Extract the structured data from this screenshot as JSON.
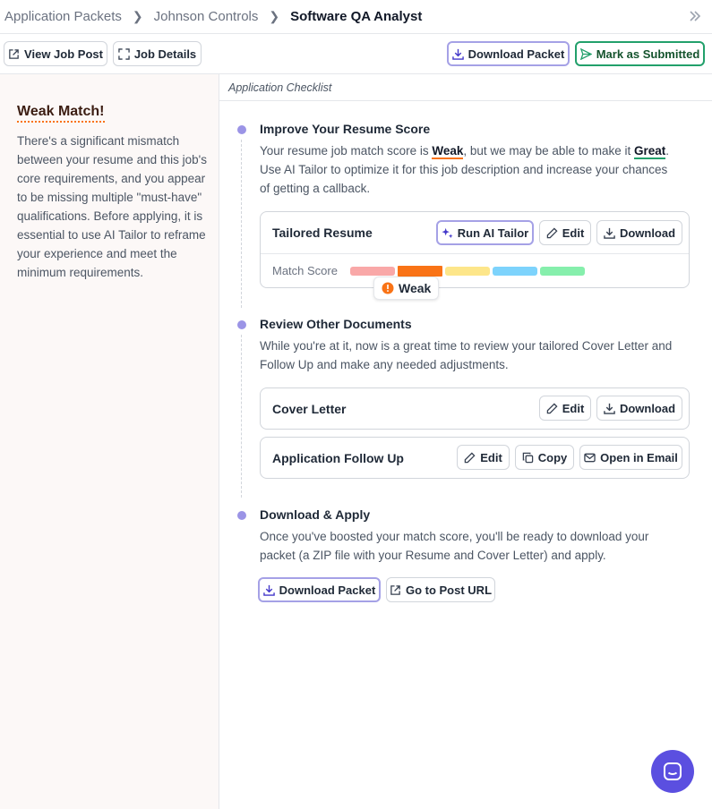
{
  "breadcrumb": {
    "items": [
      "Application Packets",
      "Johnson Controls",
      "Software QA Analyst"
    ]
  },
  "toolbar": {
    "view_job_post": "View Job Post",
    "job_details": "Job Details",
    "download_packet": "Download Packet",
    "mark_submitted": "Mark as Submitted"
  },
  "left_panel": {
    "title": "Weak Match!",
    "text": "There's a significant mismatch between your resume and this job's core requirements, and you appear to be missing multiple \"must-have\" qualifications. Before applying, it is essential to use AI Tailor to reframe your experience and meet the minimum requirements."
  },
  "checklist": {
    "header": "Application Checklist",
    "step1": {
      "title": "Improve Your Resume Score",
      "desc_a": "Your resume job match score is ",
      "desc_weak": "Weak",
      "desc_b": ", but we may be able to make it ",
      "desc_great": "Great",
      "desc_c": ". Use AI Tailor to optimize it for this job description and increase your chances of getting a callback.",
      "card_title": "Tailored Resume",
      "run_ai": "Run AI Tailor",
      "edit": "Edit",
      "download": "Download",
      "match_label": "Match Score",
      "score": "Weak",
      "score_level": 2,
      "score_levels": 5,
      "scale_colors": [
        "#f9a8a8",
        "#f97316",
        "#fde68a",
        "#7dd3fc",
        "#86efac"
      ]
    },
    "step2": {
      "title": "Review Other Documents",
      "desc": "While you're at it, now is a great time to review your tailored Cover Letter and Follow Up and make any needed adjustments.",
      "cover_title": "Cover Letter",
      "cover_edit": "Edit",
      "cover_download": "Download",
      "followup_title": "Application Follow Up",
      "followup_edit": "Edit",
      "followup_copy": "Copy",
      "followup_email": "Open in Email"
    },
    "step3": {
      "title": "Download & Apply",
      "desc": "Once you've boosted your match score, you'll be ready to download your packet (a ZIP file with your Resume and Cover Letter) and apply.",
      "download_packet": "Download Packet",
      "go_to_post": "Go to Post URL"
    }
  },
  "colors": {
    "accent": "#a5a1e6",
    "submit_green": "#22a06b",
    "weak_orange": "#f97316",
    "chat_bg": "#5b4fe0"
  },
  "icons": [
    "external-link-icon",
    "expand-icon",
    "download-icon",
    "send-icon",
    "sparkle-icon",
    "pencil-icon",
    "copy-icon",
    "mail-icon",
    "alert-icon",
    "chat-icon",
    "double-chevron-icon"
  ]
}
